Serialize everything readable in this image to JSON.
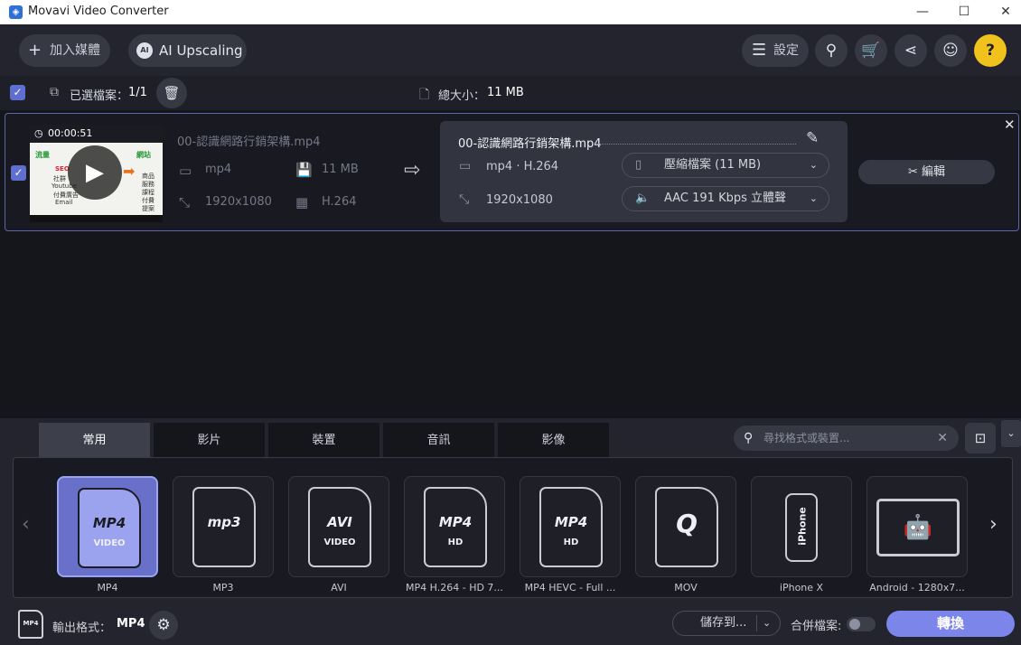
{
  "window": {
    "title": "Movavi Video Converter",
    "minimize": "—",
    "maximize": "☐",
    "close": "✕"
  },
  "toolbar": {
    "add_media": "加入媒體",
    "ai_upscaling": "AI Upscaling",
    "settings": "設定",
    "help": "?"
  },
  "selection": {
    "selected_label": "已選檔案：",
    "selected_count": "1/1",
    "total_size_label": "總大小：",
    "total_size": "11 MB"
  },
  "file": {
    "duration": "00:00:51",
    "source_name": "00-認識網路行銷架構.mp4",
    "source_format": "mp4",
    "source_size": "11 MB",
    "source_resolution": "1920x1080",
    "source_codec": "H.264",
    "output_name": "00-認識網路行銷架構.mp4",
    "output_format": "mp4 · H.264",
    "output_resolution": "1920x1080",
    "compress": "壓縮檔案 (11 MB)",
    "audio": "AAC 191 Kbps 立體聲",
    "edit": "編輯",
    "thumb_text": {
      "a": "流量",
      "b": "SEO",
      "c": "社群",
      "d": "Youtube",
      "e": "付費廣告",
      "f": "Email",
      "g": "網站",
      "h": "商品",
      "i": "服務",
      "j": "課程",
      "k": "付費",
      "l": "提案"
    }
  },
  "tabs": [
    "常用",
    "影片",
    "裝置",
    "音訊",
    "影像"
  ],
  "search": {
    "placeholder": "尋找格式或裝置..."
  },
  "formats": [
    {
      "mark": "MP4",
      "sub": "VIDEO",
      "label": "MP4"
    },
    {
      "mark": "mp3",
      "sub": "",
      "label": "MP3"
    },
    {
      "mark": "AVI",
      "sub": "VIDEO",
      "label": "AVI"
    },
    {
      "mark": "MP4",
      "sub": "HD",
      "label": "MP4 H.264 - HD 7..."
    },
    {
      "mark": "MP4",
      "sub": "HD",
      "label": "MP4 HEVC - Full ..."
    },
    {
      "mark": "Q",
      "sub": "",
      "label": "MOV"
    },
    {
      "mark": "iPhone",
      "sub": "",
      "label": "iPhone X"
    },
    {
      "mark": "🤖",
      "sub": "",
      "label": "Android - 1280x7..."
    }
  ],
  "footer": {
    "output_label": "輸出格式：",
    "output_value": "MP4",
    "mini": "MP4",
    "save_to": "儲存到...",
    "merge": "合併檔案:",
    "convert": "轉換"
  },
  "colors": {
    "accent": "#7c85ea",
    "help": "#f1c21b"
  }
}
